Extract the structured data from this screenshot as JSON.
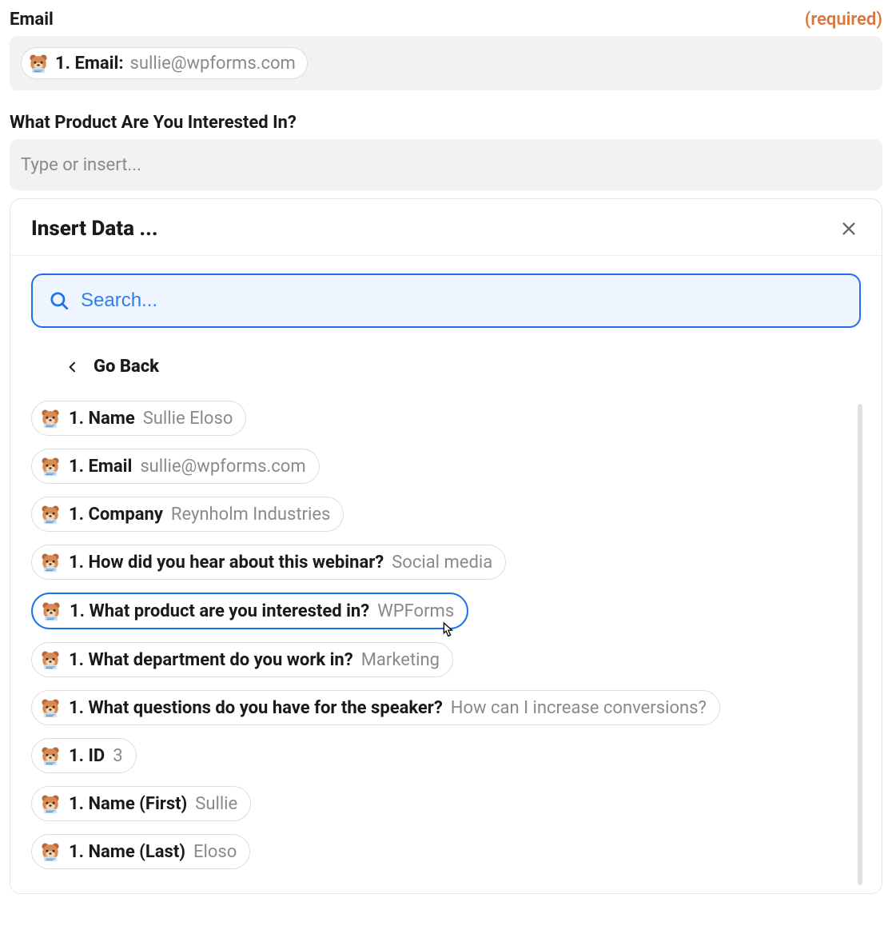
{
  "fields": {
    "email": {
      "label": "Email",
      "required_text": "(required)",
      "chip_label": "1. Email:",
      "chip_value": "sullie@wpforms.com"
    },
    "product": {
      "label": "What Product Are You Interested In?",
      "placeholder": "Type or insert..."
    }
  },
  "modal": {
    "title": "Insert Data ...",
    "search_placeholder": "Search...",
    "go_back_label": "Go Back",
    "items": [
      {
        "label": "1. Name",
        "value": "Sullie Eloso",
        "selected": false
      },
      {
        "label": "1. Email",
        "value": "sullie@wpforms.com",
        "selected": false
      },
      {
        "label": "1. Company",
        "value": "Reynholm Industries",
        "selected": false
      },
      {
        "label": "1. How did you hear about this webinar?",
        "value": "Social media",
        "selected": false
      },
      {
        "label": "1. What product are you interested in?",
        "value": "WPForms",
        "selected": true
      },
      {
        "label": "1. What department do you work in?",
        "value": "Marketing",
        "selected": false
      },
      {
        "label": "1. What questions do you have for the speaker?",
        "value": "How can I increase conversions?",
        "selected": false
      },
      {
        "label": "1. ID",
        "value": "3",
        "selected": false
      },
      {
        "label": "1. Name (First)",
        "value": "Sullie",
        "selected": false
      },
      {
        "label": "1. Name (Last)",
        "value": "Eloso",
        "selected": false
      }
    ]
  }
}
